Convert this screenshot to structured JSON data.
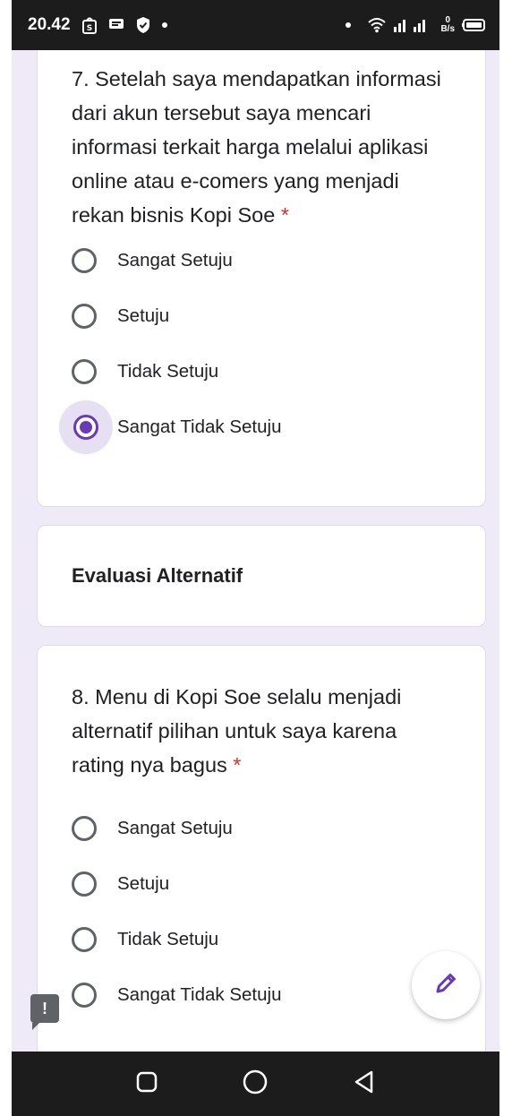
{
  "status_bar": {
    "time": "20.42",
    "net_speed_value": "0",
    "net_speed_unit": "B/s"
  },
  "question7": {
    "number_title": "7. Setelah saya mendapatkan informasi dari akun tersebut saya mencari informasi terkait harga melalui aplikasi online atau e-comers yang menjadi rekan bisnis Kopi Soe",
    "required_mark": "*",
    "options": [
      "Sangat Setuju",
      "Setuju",
      "Tidak Setuju",
      "Sangat Tidak Setuju"
    ],
    "selected": "Sangat Tidak Setuju"
  },
  "section": {
    "title": "Evaluasi Alternatif"
  },
  "question8": {
    "number_title": "8. Menu di Kopi Soe selalu menjadi alternatif pilihan untuk saya karena rating nya bagus",
    "required_mark": "*",
    "options": [
      "Sangat Setuju",
      "Setuju",
      "Tidak Setuju",
      "Sangat Tidak Setuju"
    ],
    "selected": null
  },
  "feedback": {
    "symbol": "!"
  },
  "colors": {
    "accent": "#673ab7",
    "required": "#d93025",
    "background": "#efeaf7"
  },
  "icons": [
    "shopee-icon",
    "message-icon",
    "shield-icon",
    "wifi-icon",
    "signal-icon",
    "battery-icon",
    "edit-pencil-icon",
    "feedback-icon",
    "recents-icon",
    "home-icon",
    "back-icon"
  ]
}
